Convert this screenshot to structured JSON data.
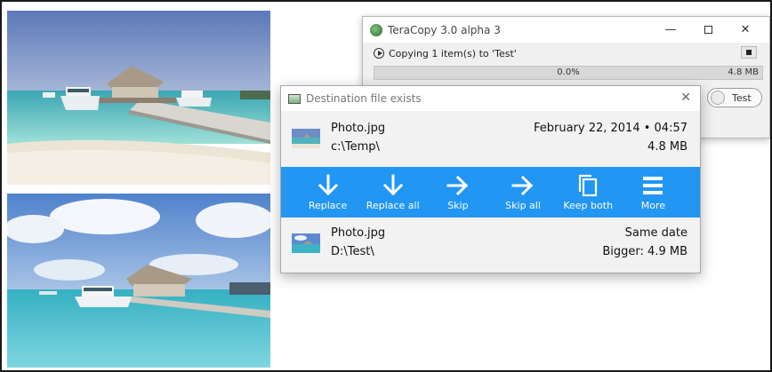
{
  "teracopy": {
    "title": "TeraCopy 3.0 alpha 3",
    "status": "Copying 1 item(s) to 'Test'",
    "progress_value": 0.0,
    "progress_percent_label": "0.0%",
    "progress_size_label": "4.8 MB",
    "toggle_label": "Test",
    "icons": {
      "logo": "teracopy-logo-icon",
      "play": "play-circle-icon",
      "stop": "stop-icon",
      "min": "minimize-icon",
      "max": "maximize-icon",
      "close": "close-icon"
    }
  },
  "dialog": {
    "title": "Destination file exists",
    "source": {
      "name": "Photo.jpg",
      "path": "c:\\Temp\\",
      "date": "February 22, 2014 • 04:57",
      "size": "4.8 MB"
    },
    "destination": {
      "name": "Photo.jpg",
      "path": "D:\\Test\\",
      "date": "Same date",
      "size": "Bigger: 4.9 MB"
    },
    "actions": [
      {
        "label": "Replace",
        "icon": "arrow-down-icon"
      },
      {
        "label": "Replace all",
        "icon": "arrow-down-icon"
      },
      {
        "label": "Skip",
        "icon": "arrow-right-icon"
      },
      {
        "label": "Skip all",
        "icon": "arrow-right-icon"
      },
      {
        "label": "Keep both",
        "icon": "copy-icon"
      },
      {
        "label": "More",
        "icon": "menu-icon"
      }
    ],
    "accent_color": "#2196f3"
  }
}
